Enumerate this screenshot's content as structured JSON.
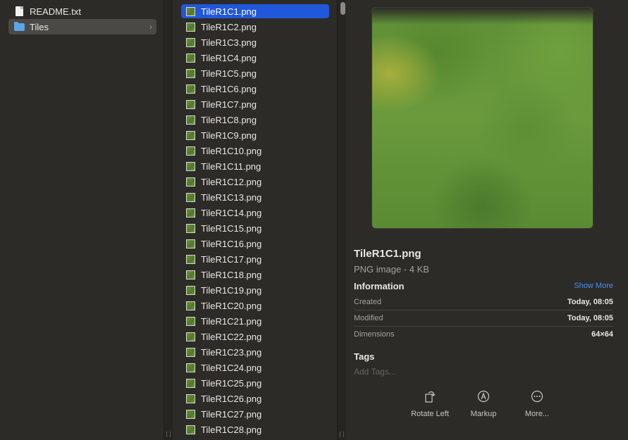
{
  "sidebar": {
    "items": [
      {
        "label": "README.txt",
        "icon": "document-icon"
      },
      {
        "label": "Tiles",
        "icon": "folder-icon",
        "chevron": "›"
      }
    ]
  },
  "files": [
    "TileR1C1.png",
    "TileR1C2.png",
    "TileR1C3.png",
    "TileR1C4.png",
    "TileR1C5.png",
    "TileR1C6.png",
    "TileR1C7.png",
    "TileR1C8.png",
    "TileR1C9.png",
    "TileR1C10.png",
    "TileR1C11.png",
    "TileR1C12.png",
    "TileR1C13.png",
    "TileR1C14.png",
    "TileR1C15.png",
    "TileR1C16.png",
    "TileR1C17.png",
    "TileR1C18.png",
    "TileR1C19.png",
    "TileR1C20.png",
    "TileR1C21.png",
    "TileR1C22.png",
    "TileR1C23.png",
    "TileR1C24.png",
    "TileR1C25.png",
    "TileR1C26.png",
    "TileR1C27.png",
    "TileR1C28.png"
  ],
  "selected_file_index": 0,
  "preview": {
    "name": "TileR1C1.png",
    "kind": "PNG image - 4 KB",
    "information_label": "Information",
    "show_more": "Show More",
    "rows": [
      {
        "key": "Created",
        "value": "Today, 08:05"
      },
      {
        "key": "Modified",
        "value": "Today, 08:05"
      },
      {
        "key": "Dimensions",
        "value": "64×64"
      }
    ],
    "tags_label": "Tags",
    "tags_placeholder": "Add Tags...",
    "actions": [
      {
        "label": "Rotate Left",
        "icon": "rotate-left-icon"
      },
      {
        "label": "Markup",
        "icon": "markup-icon"
      },
      {
        "label": "More...",
        "icon": "more-icon"
      }
    ]
  },
  "colors": {
    "selection": "#2157d9",
    "link": "#4a8ef0",
    "folder": "#5aa6e6"
  }
}
